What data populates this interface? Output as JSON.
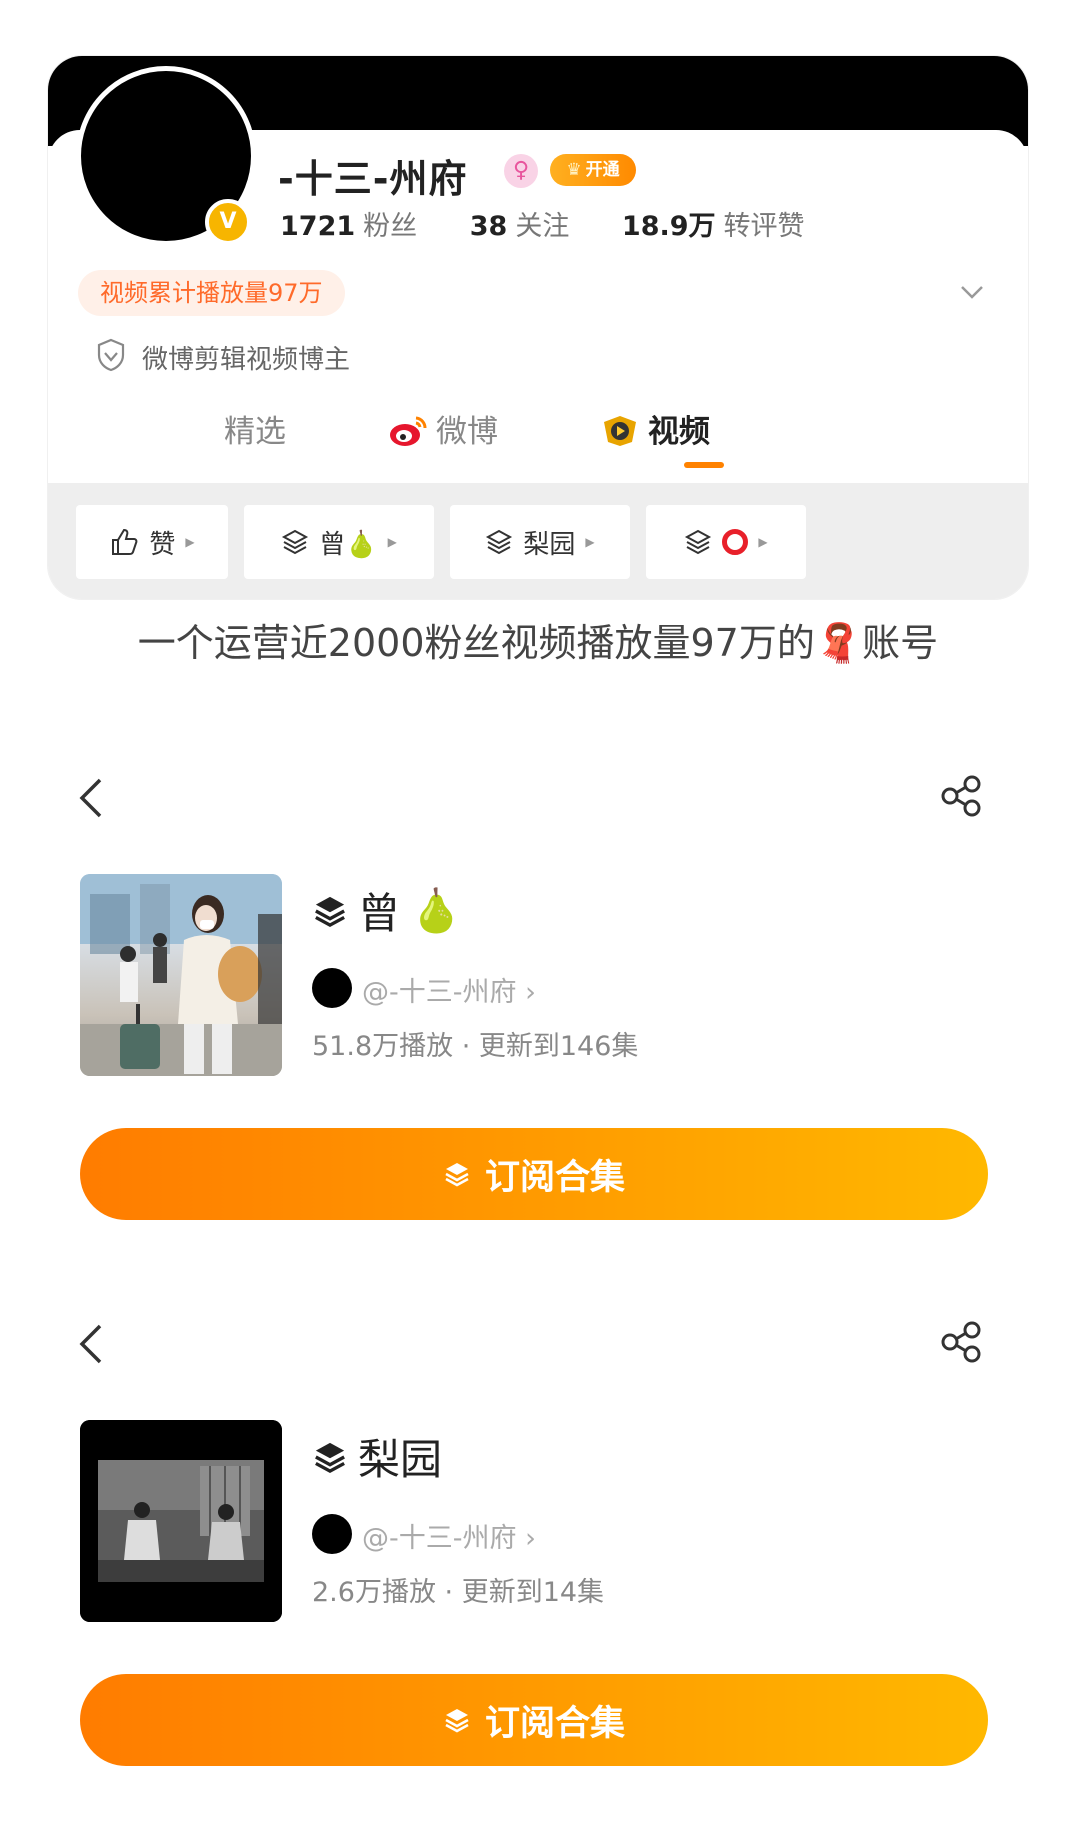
{
  "profile": {
    "username": "-十三-州府",
    "vip_label": "开通",
    "stats": [
      {
        "value": "1721",
        "label": "粉丝"
      },
      {
        "value": "38",
        "label": "关注"
      },
      {
        "value": "18.9万",
        "label": "转评赞"
      }
    ],
    "play_badge": "视频累计播放量97万",
    "certification": "微博剪辑视频博主"
  },
  "tabs": [
    {
      "label": "精选",
      "active": false
    },
    {
      "label": "微博",
      "active": false
    },
    {
      "label": "视频",
      "active": true
    }
  ],
  "filters": [
    {
      "label": "赞",
      "icon": "thumbs-up-icon"
    },
    {
      "label": "曾",
      "icon": "stack-icon",
      "emoji": "🍐"
    },
    {
      "label": "梨园",
      "icon": "stack-icon"
    },
    {
      "label": "",
      "icon": "stack-icon",
      "emoji": "⭕"
    }
  ],
  "caption": "一个运营近2000粉丝视频播放量97万的🧣账号",
  "collections": [
    {
      "title": "曾",
      "emoji": "🍐",
      "author": "@-十三-州府 ›",
      "plays": "51.8万播放",
      "updated": "更新到146集",
      "subscribe_label": "订阅合集"
    },
    {
      "title": "梨园",
      "emoji": "",
      "author": "@-十三-州府 ›",
      "plays": "2.6万播放",
      "updated": "更新到14集",
      "subscribe_label": "订阅合集"
    }
  ],
  "colors": {
    "accent": "#ff8200",
    "vip": "#ffb020",
    "badge_text": "#ff6a2a"
  }
}
